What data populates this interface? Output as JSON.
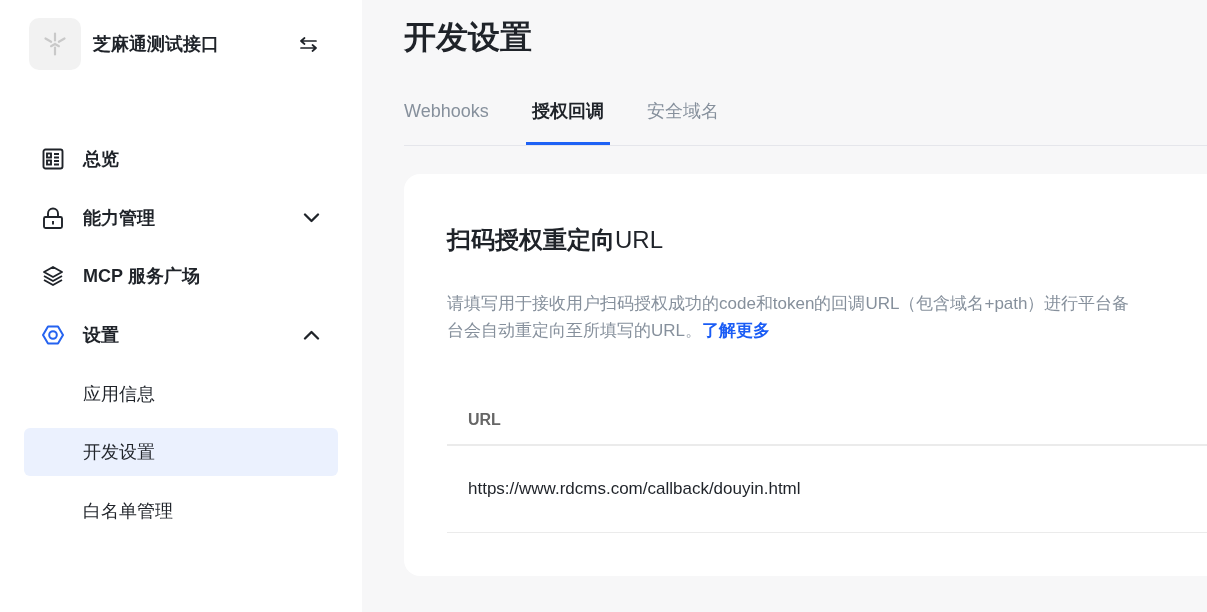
{
  "sidebar": {
    "app_name": "芝麻通测试接口",
    "items": [
      {
        "kind": "link",
        "label": "总览",
        "selected": false
      },
      {
        "kind": "group",
        "label": "能力管理",
        "selected": false,
        "expanded": false
      },
      {
        "kind": "link",
        "label": "MCP 服务广场",
        "selected": false
      },
      {
        "kind": "group",
        "label": "设置",
        "selected": false,
        "expanded": true,
        "children": [
          {
            "label": "应用信息",
            "selected": false
          },
          {
            "label": "开发设置",
            "selected": true
          },
          {
            "label": "白名单管理",
            "selected": false
          }
        ]
      }
    ]
  },
  "page": {
    "title": "开发设置",
    "tabs": [
      {
        "label": "Webhooks",
        "selected": false
      },
      {
        "label": "授权回调",
        "selected": true
      },
      {
        "label": "安全域名",
        "selected": false
      }
    ]
  },
  "card": {
    "title": "**扫码授权重定向**URL",
    "description": "请填写用于接收用户扫码授权成功的code和token的回调URL（包含域名+path）进行平台备",
    "description_continued": "台会自动重定向至所填写的URL。",
    "learn_more_link": "了解更多",
    "table": {
      "columns": [
        "URL"
      ],
      "rows": [
        [
          "https://www.rdcms.com/callback/douyin.html"
        ]
      ]
    }
  }
}
